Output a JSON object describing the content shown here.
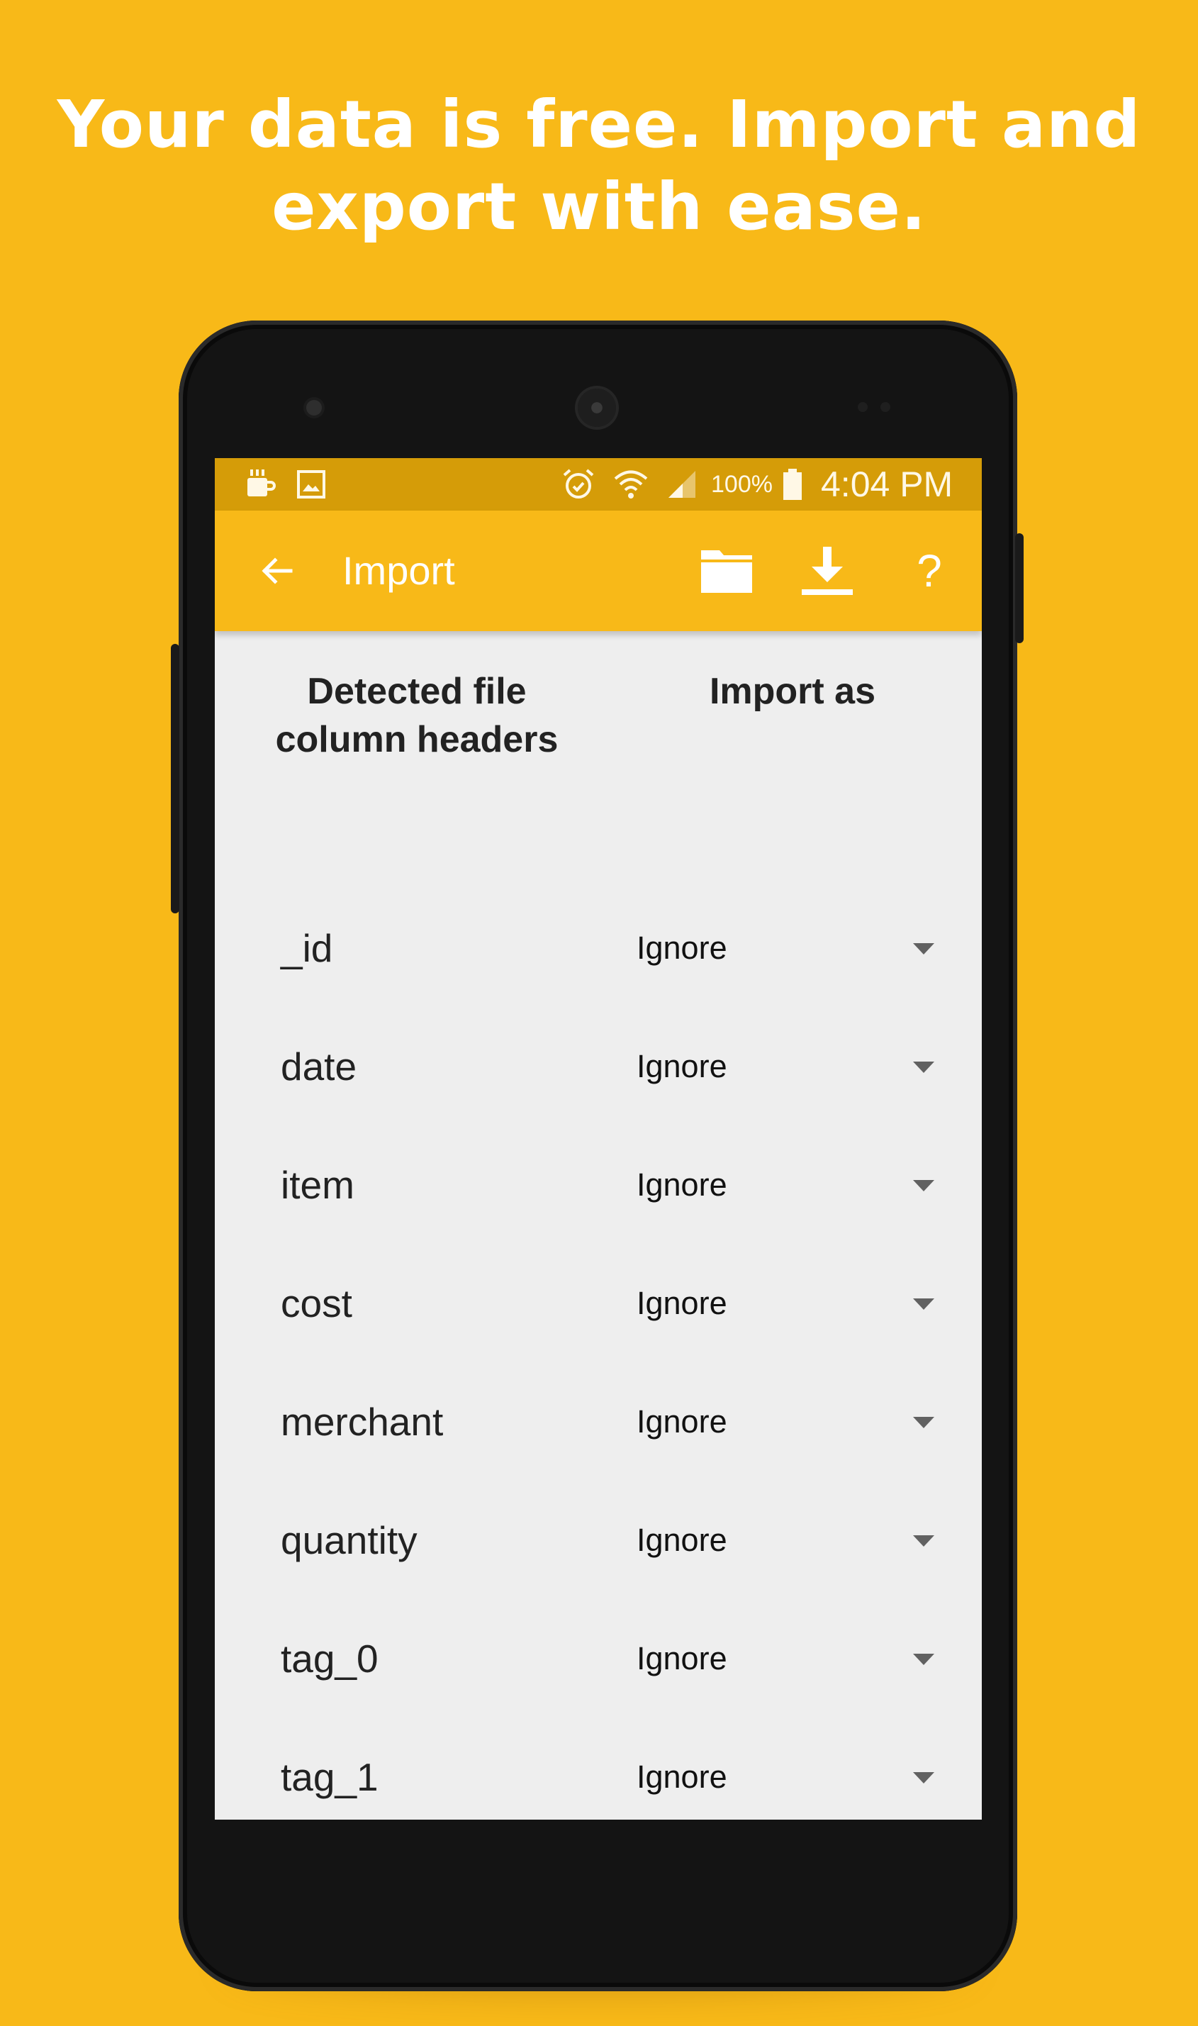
{
  "headline": {
    "line1": "Your data is free. Import and",
    "line2": "export with ease."
  },
  "status_bar": {
    "left_icons": [
      "coffee-cup-icon",
      "image-icon"
    ],
    "right_icons": [
      "alarm-icon",
      "wifi-icon",
      "signal-icon",
      "battery-icon"
    ],
    "battery": "100%",
    "time": "4:04 PM"
  },
  "app_bar": {
    "title": "Import",
    "back_icon": "arrow-back-icon",
    "actions": [
      "folder-icon",
      "download-icon",
      "help-icon"
    ],
    "help_glyph": "?"
  },
  "table": {
    "header_left_line1": "Detected file",
    "header_left_line2": "column headers",
    "header_right": "Import as",
    "rows": [
      {
        "column": "_id",
        "import_as": "Ignore"
      },
      {
        "column": "date",
        "import_as": "Ignore"
      },
      {
        "column": "item",
        "import_as": "Ignore"
      },
      {
        "column": "cost",
        "import_as": "Ignore"
      },
      {
        "column": "merchant",
        "import_as": "Ignore"
      },
      {
        "column": "quantity",
        "import_as": "Ignore"
      },
      {
        "column": "tag_0",
        "import_as": "Ignore"
      },
      {
        "column": "tag_1",
        "import_as": "Ignore"
      }
    ]
  },
  "colors": {
    "background": "#F8B918",
    "status_bar": "#D59C08",
    "app_bar": "#F8B918",
    "screen": "#EEEEEE"
  }
}
